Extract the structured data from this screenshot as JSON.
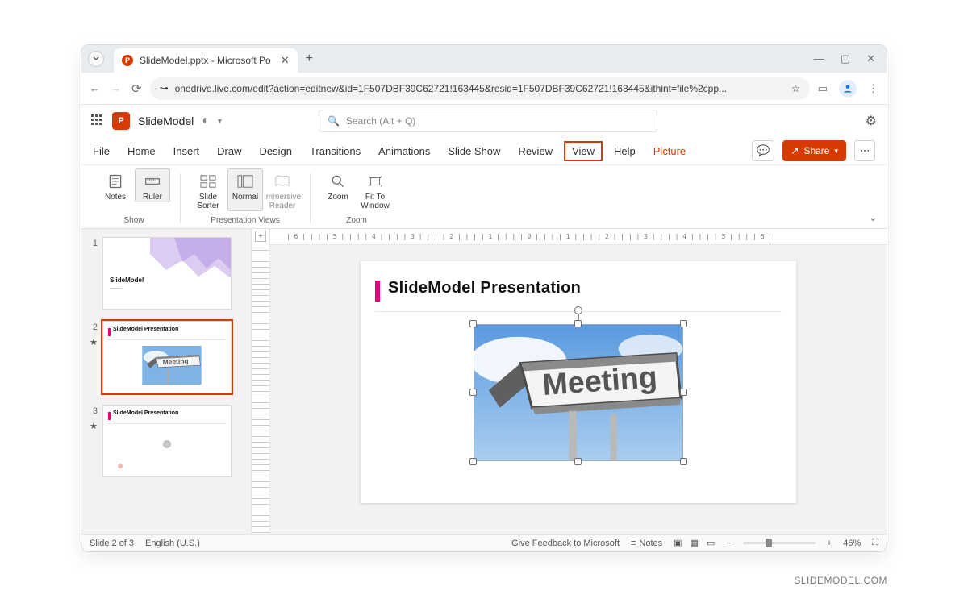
{
  "browser": {
    "tab_title": "SlideModel.pptx - Microsoft Po",
    "url": "onedrive.live.com/edit?action=editnew&id=1F507DBF39C62721!163445&resid=1F507DBF39C62721!163445&ithint=file%2cpp..."
  },
  "app": {
    "logo_letter": "P",
    "doc_name": "SlideModel",
    "search_placeholder": "Search (Alt + Q)"
  },
  "ribbon_tabs": {
    "file": "File",
    "home": "Home",
    "insert": "Insert",
    "draw": "Draw",
    "design": "Design",
    "transitions": "Transitions",
    "animations": "Animations",
    "slideshow": "Slide Show",
    "review": "Review",
    "view": "View",
    "help": "Help",
    "picture": "Picture",
    "share": "Share"
  },
  "ribbon": {
    "notes": "Notes",
    "ruler": "Ruler",
    "slide_sorter_l1": "Slide",
    "slide_sorter_l2": "Sorter",
    "normal": "Normal",
    "immersive_l1": "Immersive",
    "immersive_l2": "Reader",
    "zoom": "Zoom",
    "fit_l1": "Fit To",
    "fit_l2": "Window",
    "group_show": "Show",
    "group_views": "Presentation Views",
    "group_zoom": "Zoom"
  },
  "thumbs": {
    "n1": "1",
    "n2": "2",
    "n3": "3",
    "t1_title": "SlideModel",
    "t2_title": "SlideModel Presentation",
    "t3_title": "SlideModel Presentation"
  },
  "slide": {
    "title": "SlideModel Presentation",
    "image_text": "Meeting"
  },
  "ruler_text": "| 6 | | | | 5 | | | | 4 | | | | 3 | | | | 2 | | | | 1 | | | | 0 | | | | 1 | | | | 2 | | | | 3 | | | | 4 | | | | 5 | | | | 6 |",
  "status": {
    "slide": "Slide 2 of 3",
    "lang": "English (U.S.)",
    "feedback": "Give Feedback to Microsoft",
    "notes": "Notes",
    "zoom_pct": "46%"
  },
  "watermark": "SLIDEMODEL.COM"
}
